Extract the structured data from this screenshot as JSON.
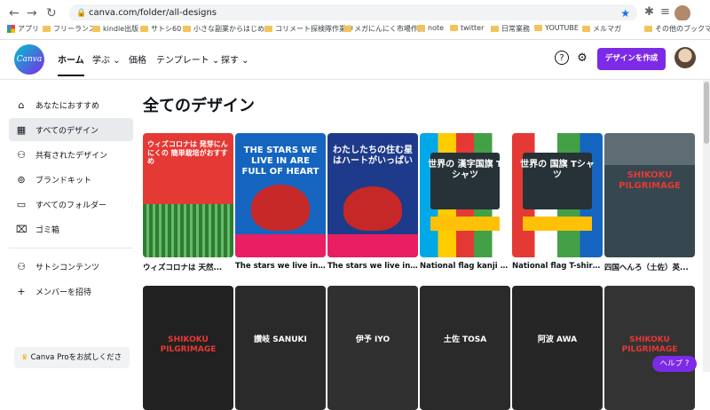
{
  "browser": {
    "url": "canva.com/folder/all-designs",
    "bookmarks": [
      "アプリ",
      "フリーランス",
      "kindle出版",
      "サトシ60",
      "小さな副業からはじめ...",
      "コリメート探検隊作業中",
      "メガにんにく市場作業",
      "note",
      "twitter",
      "日常業務",
      "YOUTUBE",
      "メルマガ",
      "その他のブックマーク"
    ]
  },
  "topbar": {
    "logo": "Canva",
    "nav": [
      "ホーム",
      "学ぶ ⌄",
      "価格",
      "テンプレート ⌄",
      "探す ⌄"
    ],
    "create_label": "デザインを作成"
  },
  "sidebar": {
    "items": [
      {
        "icon": "home-icon",
        "glyph": "⌂",
        "label": "あなたにおすすめ"
      },
      {
        "icon": "grid-icon",
        "glyph": "▦",
        "label": "すべてのデザイン"
      },
      {
        "icon": "people-icon",
        "glyph": "⚇",
        "label": "共有されたデザイン"
      },
      {
        "icon": "brand-kit-icon",
        "glyph": "⊚",
        "label": "ブランドキット"
      },
      {
        "icon": "folder-icon",
        "glyph": "▭",
        "label": "すべてのフォルダー"
      },
      {
        "icon": "trash-icon",
        "glyph": "🗑",
        "label": "ゴミ箱"
      },
      {
        "icon": "team-icon",
        "glyph": "⚇",
        "label": "サトシコンテンツ"
      },
      {
        "icon": "plus-icon",
        "glyph": "+",
        "label": "メンバーを招待"
      }
    ],
    "pro_label": "Canva Proをお試しくださ"
  },
  "main": {
    "title": "全てのデザイン",
    "designs": [
      {
        "caption": "ウィズコロナは 天然...",
        "title": "ウィズコロナは 発芽にんにくの 簡単栽培がおすすめ",
        "bg": "#e53935"
      },
      {
        "caption": "The stars we live in a...",
        "title": "THE STARS WE LIVE IN ARE FULL OF HEART",
        "bg": "#1565c0"
      },
      {
        "caption": "The stars we live in a...",
        "title": "わたしたちの住む星はハートがいっぱい",
        "bg": "#1e3a8a"
      },
      {
        "caption": "National flag kanji T...",
        "title": "世界の 漢字国旗 Tシャツ",
        "bg": "#263238"
      },
      {
        "caption": "National flag T-shirt ...",
        "title": "世界の 国旗 Tシャツ",
        "bg": "#263238"
      },
      {
        "caption": "四国へんろ（土佐）英...",
        "title": "SHIKOKU PILGRIMAGE",
        "bg": "#37474f"
      }
    ],
    "row2": [
      {
        "label": "SHIKOKU PILGRIMAGE",
        "bg": "#212121"
      },
      {
        "label": "讃岐 SANUKI",
        "bg": "#2a2a2a"
      },
      {
        "label": "伊予 IYO",
        "bg": "#303030"
      },
      {
        "label": "土佐 TOSA",
        "bg": "#2a2a2a"
      },
      {
        "label": "阿波 AWA",
        "bg": "#262626"
      },
      {
        "label": "SHIKOKU PILGRIMAGE",
        "bg": "#333333"
      }
    ]
  },
  "help_label": "ヘルプ ?"
}
